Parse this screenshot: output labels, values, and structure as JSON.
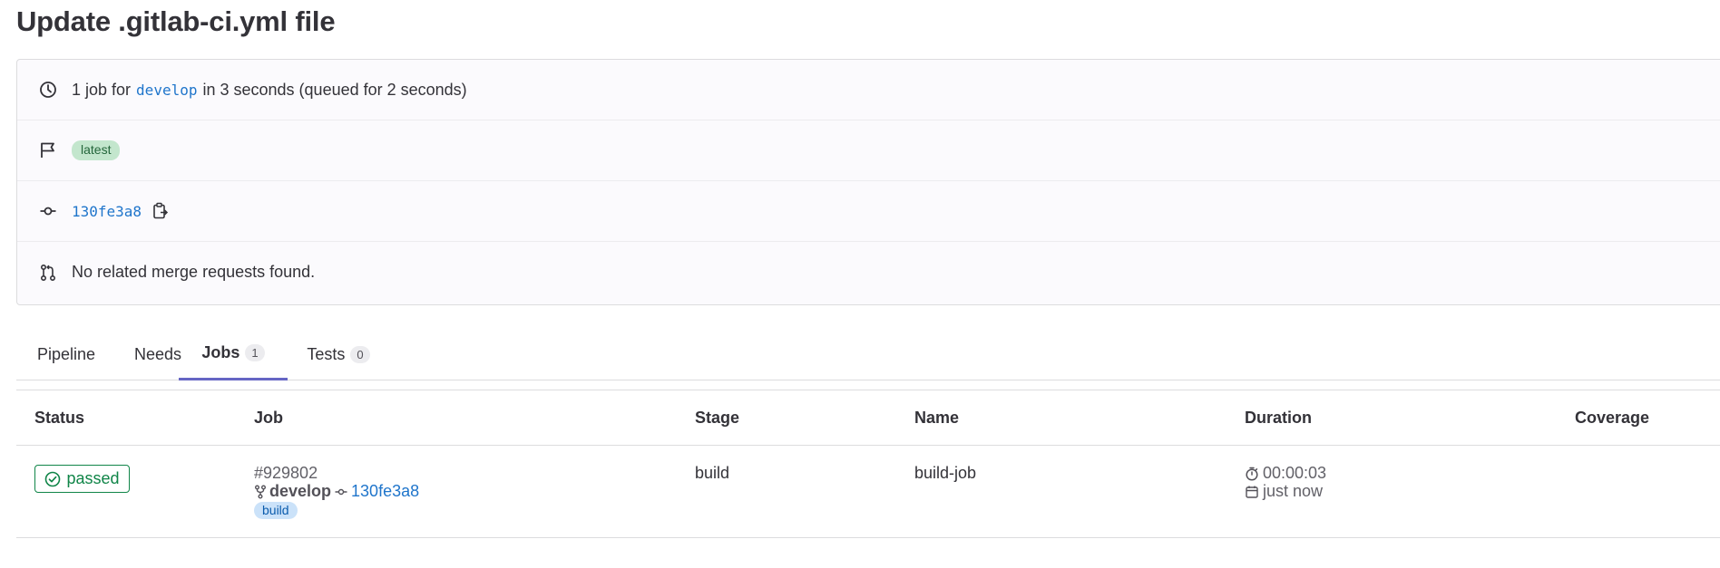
{
  "page": {
    "title": "Update .gitlab-ci.yml file"
  },
  "info": {
    "jobs_summary_prefix": "1 job for",
    "branch": "develop",
    "jobs_summary_suffix": "in 3 seconds (queued for 2 seconds)",
    "latest_badge": "latest",
    "commit_sha": "130fe3a8",
    "merge_requests_text": "No related merge requests found."
  },
  "tabs": [
    {
      "label": "Pipeline"
    },
    {
      "label": "Needs"
    },
    {
      "label": "Jobs",
      "count": "1",
      "active": true
    },
    {
      "label": "Tests",
      "count": "0"
    }
  ],
  "jobs_table": {
    "headers": [
      "Status",
      "Job",
      "Stage",
      "Name",
      "Duration",
      "Coverage"
    ],
    "rows": [
      {
        "status": "passed",
        "job_id": "#929802",
        "branch": "develop",
        "commit": "130fe3a8",
        "stage_badge": "build",
        "stage": "build",
        "name": "build-job",
        "duration": "00:00:03",
        "finished": "just now",
        "coverage": ""
      }
    ]
  },
  "icons": {
    "clock": "clock-icon",
    "flag": "flag-icon",
    "commit": "commit-icon",
    "merge_request": "merge-request-icon",
    "copy": "copy-to-clipboard-icon",
    "status_success": "check-circle-icon",
    "branch": "branch-icon",
    "timer": "timer-icon",
    "calendar": "calendar-icon"
  },
  "colors": {
    "link": "#1f75cb",
    "success": "#108548",
    "tab_active_underline": "#6666c4",
    "latest_badge_bg": "#c3e6cd",
    "stage_badge_bg": "#cbe2f9"
  }
}
